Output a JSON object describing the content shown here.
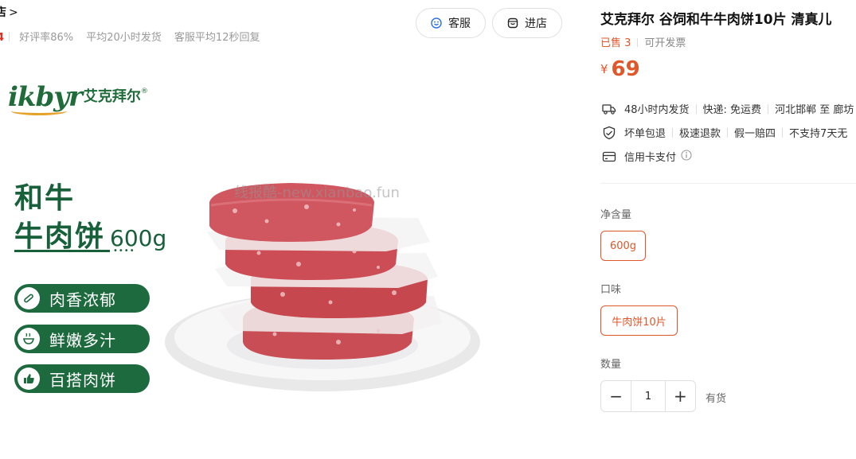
{
  "store": {
    "name_partial": "店",
    "chevron": ">",
    "mark": "4",
    "stats": [
      "好评率86%",
      "平均20小时发货",
      "客服平均12秒回复"
    ],
    "buttons": {
      "service": "客服",
      "enter_store": "进店"
    }
  },
  "product_image": {
    "brand_latin": "ikbyr",
    "brand_cn": "艾克拜尔",
    "brand_reg": "®",
    "headline_line1": "和牛",
    "headline_line2": "牛肉饼",
    "headline_weight": "600g",
    "dots": "••••",
    "features": [
      "肉香浓郁",
      "鲜嫩多汁",
      "百搭肉饼"
    ],
    "watermark": "线报酷-new.xianbao.fun"
  },
  "product": {
    "title": "艾克拜尔 谷饲和牛牛肉饼10片 清真儿",
    "sold": "已售 3",
    "invoice": "可开发票",
    "currency": "¥",
    "price": "69",
    "shipping": [
      "48小时内发货",
      "快递: 免运费",
      "河北邯郸 至 廊坊"
    ],
    "guarantees": [
      "坏单包退",
      "极速退款",
      "假一赔四",
      "不支持7天无"
    ],
    "payment": "信用卡支付"
  },
  "options": {
    "net_content_label": "净含量",
    "net_content_selected": "600g",
    "flavor_label": "口味",
    "flavor_selected": "牛肉饼10片",
    "quantity_label": "数量",
    "quantity_minus": "−",
    "quantity_value": "1",
    "quantity_plus": "+",
    "stock_status": "有货"
  },
  "colors": {
    "accent": "#e0572b",
    "brand_green": "#1d6a3e",
    "alert_red": "#e02e24"
  }
}
